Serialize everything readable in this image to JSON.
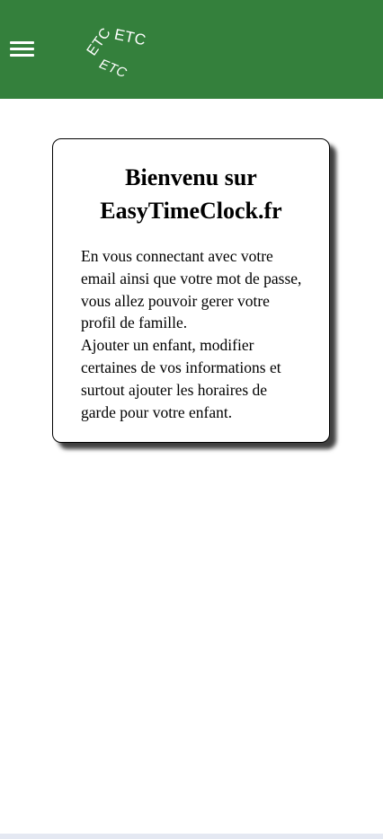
{
  "header": {
    "menu_icon": "hamburger-menu-icon",
    "logo_text_top_left": "ETC",
    "logo_text_top_right": "ETC",
    "logo_text_bottom": "ETC",
    "background_color": "#34803c"
  },
  "welcome_card": {
    "title_line1": "Bienvenu sur",
    "title_line2": "EasyTimeClock.fr",
    "paragraph1": "En vous connectant avec votre email ainsi que votre mot de passe, vous allez pouvoir gerer votre profil de famille.",
    "paragraph2": "Ajouter un enfant, modifier certaines de vos informations et surtout ajouter les horaires de garde pour votre enfant."
  }
}
